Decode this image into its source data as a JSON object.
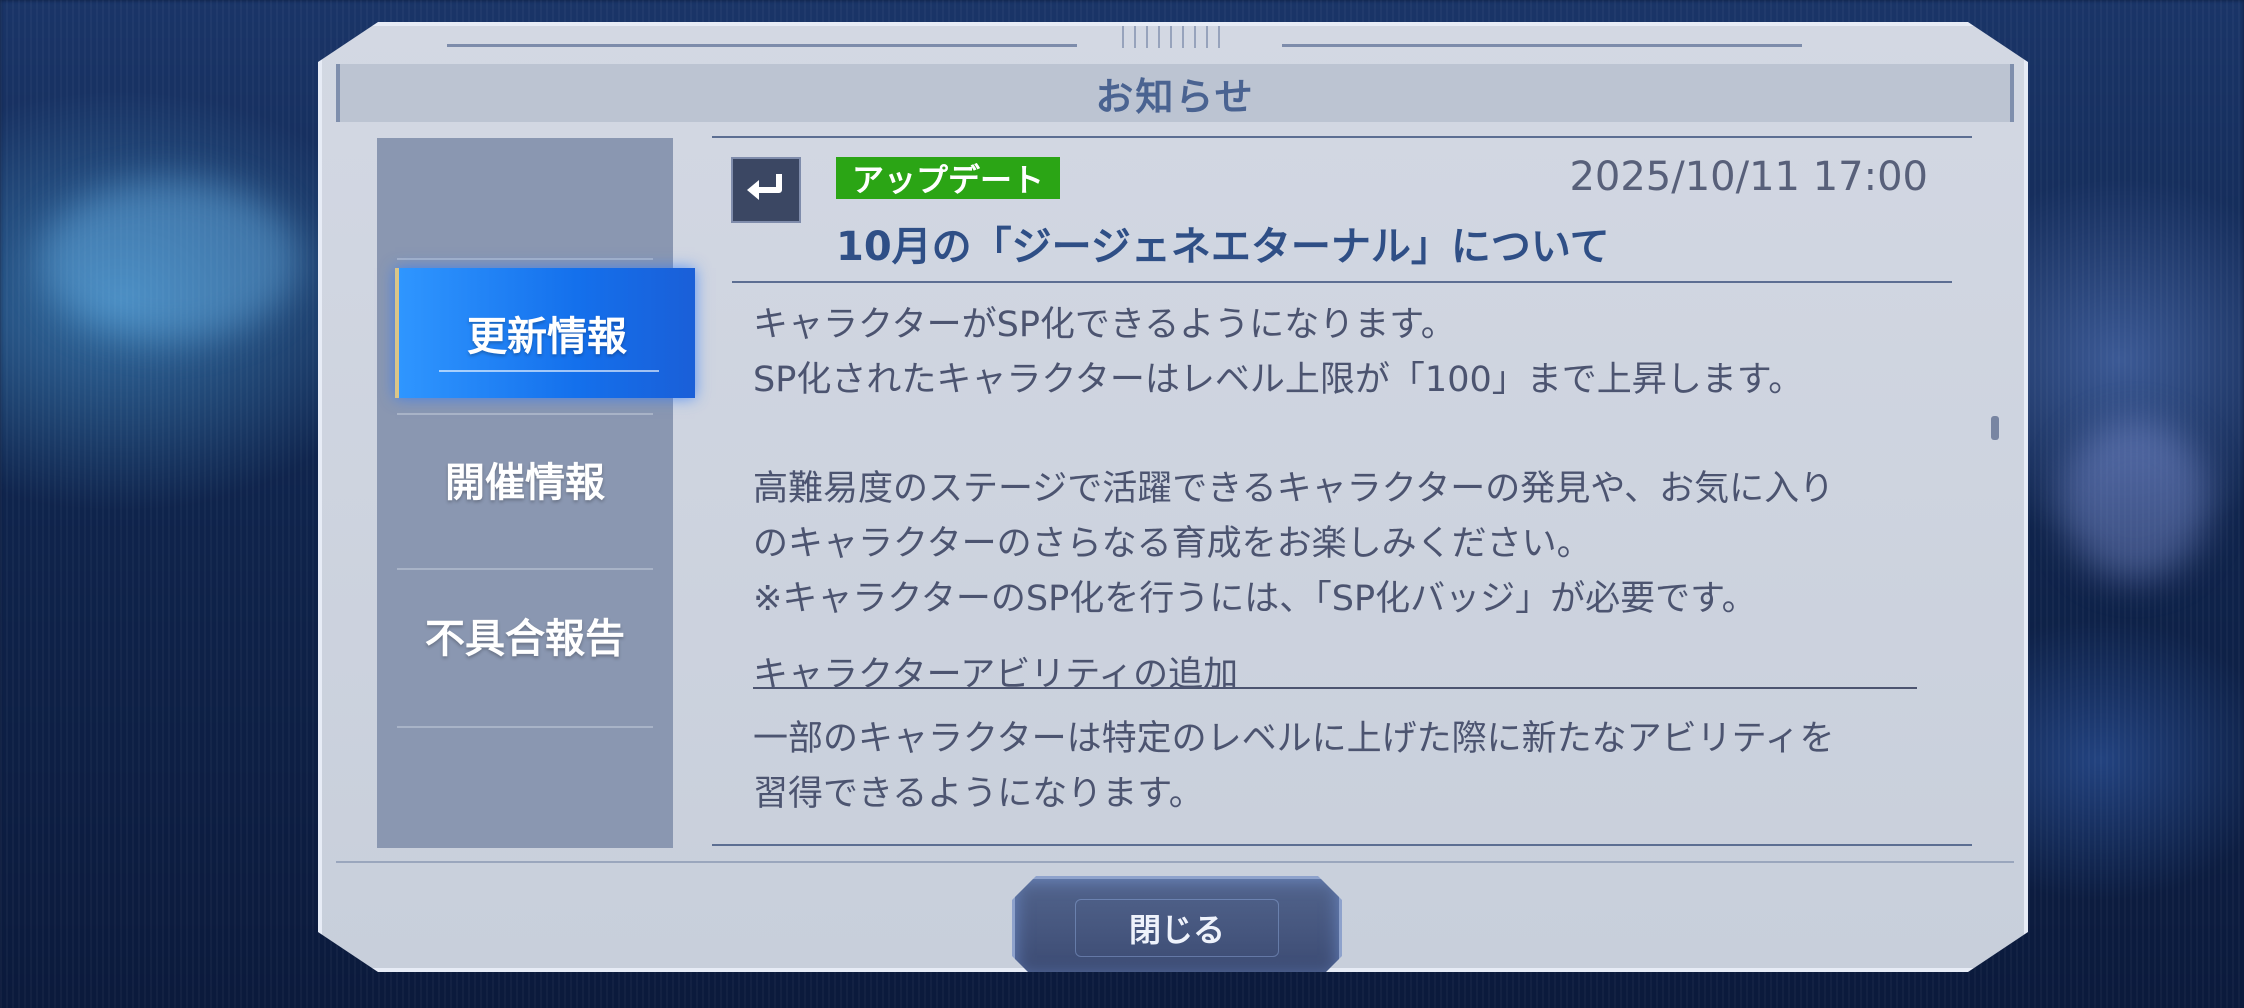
{
  "dialog": {
    "title": "お知らせ"
  },
  "sidebar": {
    "tabs": [
      {
        "label": "更新情報",
        "active": true
      },
      {
        "label": "開催情報",
        "active": false
      },
      {
        "label": "不具合報告",
        "active": false
      }
    ]
  },
  "article": {
    "badge": "アップデート",
    "badge_color": "#2ba515",
    "date": "2025/10/11 17:00",
    "headline": "10月の「ジージェネエターナル」について",
    "paragraphs": [
      "キャラクターがSP化できるようになります。",
      "SP化されたキャラクターはレベル上限が「100」まで上昇します。",
      "高難易度のステージで活躍できるキャラクターの発見や、お気に入り",
      "のキャラクターのさらなる育成をお楽しみください。",
      "※キャラクターのSP化を行うには、「SP化バッジ」が必要です。"
    ],
    "section_heading": "キャラクターアビリティの追加",
    "section_paragraphs": [
      "一部のキャラクターは特定のレベルに上げた際に新たなアビリティを",
      "習得できるようになります。"
    ]
  },
  "footer": {
    "close_label": "閉じる"
  },
  "icons": {
    "back": "return-arrow-icon"
  },
  "colors": {
    "active_tab": "#1470ec",
    "accent_text": "#2f4f86"
  }
}
